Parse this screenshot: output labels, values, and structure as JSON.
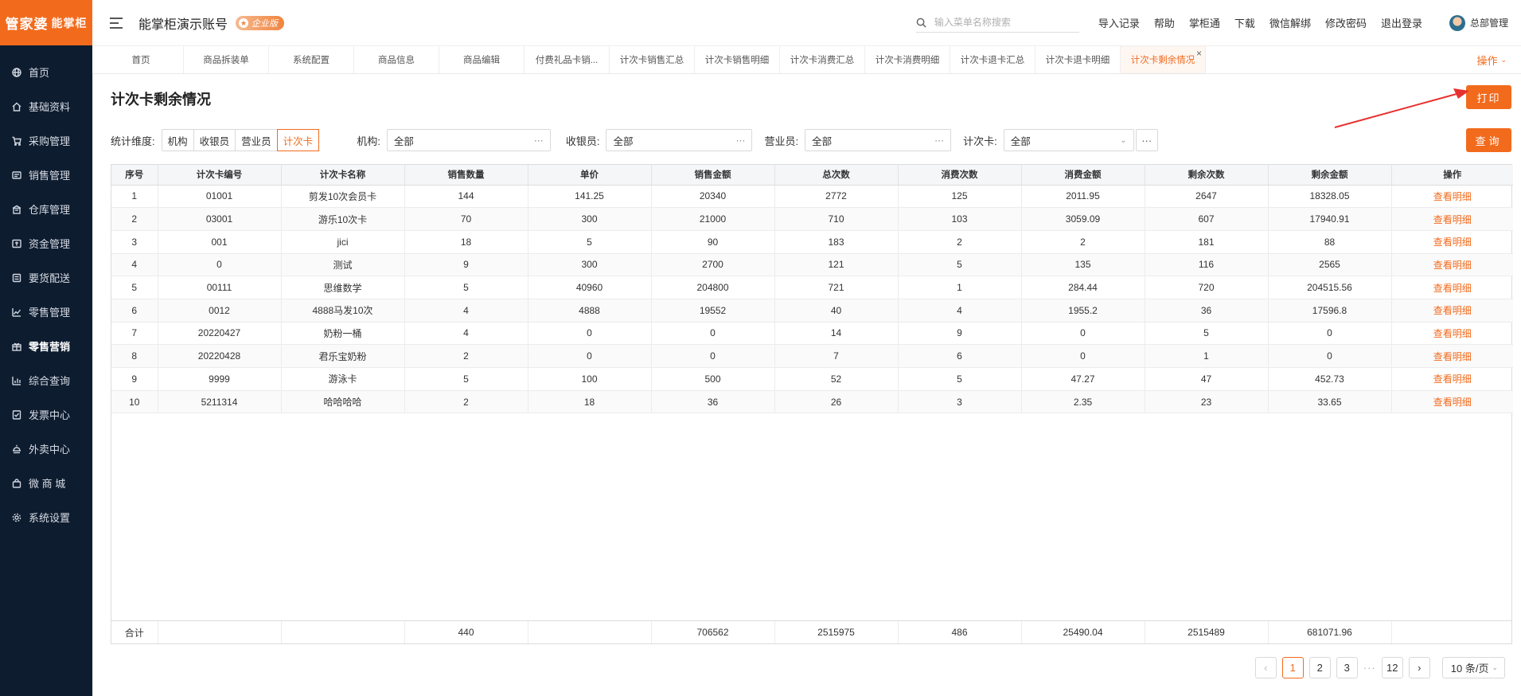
{
  "sidebar": {
    "logo_main": "管家婆",
    "logo_sub": "能掌柜",
    "items": [
      {
        "label": "首页",
        "icon": "globe-icon"
      },
      {
        "label": "基础资料",
        "icon": "home-icon"
      },
      {
        "label": "采购管理",
        "icon": "cart-icon"
      },
      {
        "label": "销售管理",
        "icon": "sales-icon"
      },
      {
        "label": "仓库管理",
        "icon": "warehouse-icon"
      },
      {
        "label": "资金管理",
        "icon": "money-icon"
      },
      {
        "label": "要货配送",
        "icon": "delivery-icon"
      },
      {
        "label": "零售管理",
        "icon": "chart-icon"
      },
      {
        "label": "零售营销",
        "icon": "gift-icon"
      },
      {
        "label": "综合查询",
        "icon": "bar-chart-icon"
      },
      {
        "label": "发票中心",
        "icon": "invoice-icon"
      },
      {
        "label": "外卖中心",
        "icon": "takeout-icon"
      },
      {
        "label": "微 商 城",
        "icon": "shop-icon"
      },
      {
        "label": "系统设置",
        "icon": "gear-icon"
      }
    ]
  },
  "header": {
    "account": "能掌柜演示账号",
    "edition": "企业版",
    "search_placeholder": "输入菜单名称搜索",
    "links": [
      "导入记录",
      "帮助",
      "掌柜通",
      "下载",
      "微信解绑",
      "修改密码",
      "退出登录"
    ],
    "user": "总部管理"
  },
  "tabs": {
    "items": [
      "首页",
      "商品拆装单",
      "系统配置",
      "商品信息",
      "商品编辑",
      "付费礼品卡销...",
      "计次卡销售汇总",
      "计次卡销售明细",
      "计次卡消费汇总",
      "计次卡消费明细",
      "计次卡退卡汇总",
      "计次卡退卡明细",
      "计次卡剩余情况"
    ],
    "close": "×",
    "ops": "操作"
  },
  "page": {
    "title": "计次卡剩余情况",
    "print": "打印",
    "query": "查询"
  },
  "filters": {
    "dimension_label": "统计维度:",
    "dimension_options": [
      "机构",
      "收银员",
      "营业员",
      "计次卡"
    ],
    "org_label": "机构:",
    "org_value": "全部",
    "cashier_label": "收银员:",
    "cashier_value": "全部",
    "salesperson_label": "营业员:",
    "salesperson_value": "全部",
    "card_label": "计次卡:",
    "card_value": "全部",
    "more": "···"
  },
  "table": {
    "columns": [
      "序号",
      "计次卡编号",
      "计次卡名称",
      "销售数量",
      "单价",
      "销售金额",
      "总次数",
      "消费次数",
      "消费金额",
      "剩余次数",
      "剩余金额",
      "操作"
    ],
    "rows": [
      [
        "1",
        "01001",
        "剪发10次会员卡",
        "144",
        "141.25",
        "20340",
        "2772",
        "125",
        "2011.95",
        "2647",
        "18328.05",
        "查看明细"
      ],
      [
        "2",
        "03001",
        "游乐10次卡",
        "70",
        "300",
        "21000",
        "710",
        "103",
        "3059.09",
        "607",
        "17940.91",
        "查看明细"
      ],
      [
        "3",
        "001",
        "jici",
        "18",
        "5",
        "90",
        "183",
        "2",
        "2",
        "181",
        "88",
        "查看明细"
      ],
      [
        "4",
        "0",
        "测试",
        "9",
        "300",
        "2700",
        "121",
        "5",
        "135",
        "116",
        "2565",
        "查看明细"
      ],
      [
        "5",
        "00111",
        "思维数学",
        "5",
        "40960",
        "204800",
        "721",
        "1",
        "284.44",
        "720",
        "204515.56",
        "查看明细"
      ],
      [
        "6",
        "0012",
        "4888马发10次",
        "4",
        "4888",
        "19552",
        "40",
        "4",
        "1955.2",
        "36",
        "17596.8",
        "查看明细"
      ],
      [
        "7",
        "20220427",
        "奶粉一桶",
        "4",
        "0",
        "0",
        "14",
        "9",
        "0",
        "5",
        "0",
        "查看明细"
      ],
      [
        "8",
        "20220428",
        "君乐宝奶粉",
        "2",
        "0",
        "0",
        "7",
        "6",
        "0",
        "1",
        "0",
        "查看明细"
      ],
      [
        "9",
        "9999",
        "游泳卡",
        "5",
        "100",
        "500",
        "52",
        "5",
        "47.27",
        "47",
        "452.73",
        "查看明细"
      ],
      [
        "10",
        "5211314",
        "哈哈哈哈",
        "2",
        "18",
        "36",
        "26",
        "3",
        "2.35",
        "23",
        "33.65",
        "查看明细"
      ]
    ],
    "total": [
      "合计",
      "",
      "",
      "440",
      "",
      "706562",
      "2515975",
      "486",
      "25490.04",
      "2515489",
      "681071.96",
      ""
    ]
  },
  "pagination": {
    "prev": "‹",
    "next": "›",
    "pages": [
      "1",
      "2",
      "3"
    ],
    "ellipsis": "···",
    "last": "12",
    "page_size": "10 条/页"
  },
  "colors": {
    "accent": "#f26b1d",
    "sidebar_bg": "#0e1c2f"
  }
}
